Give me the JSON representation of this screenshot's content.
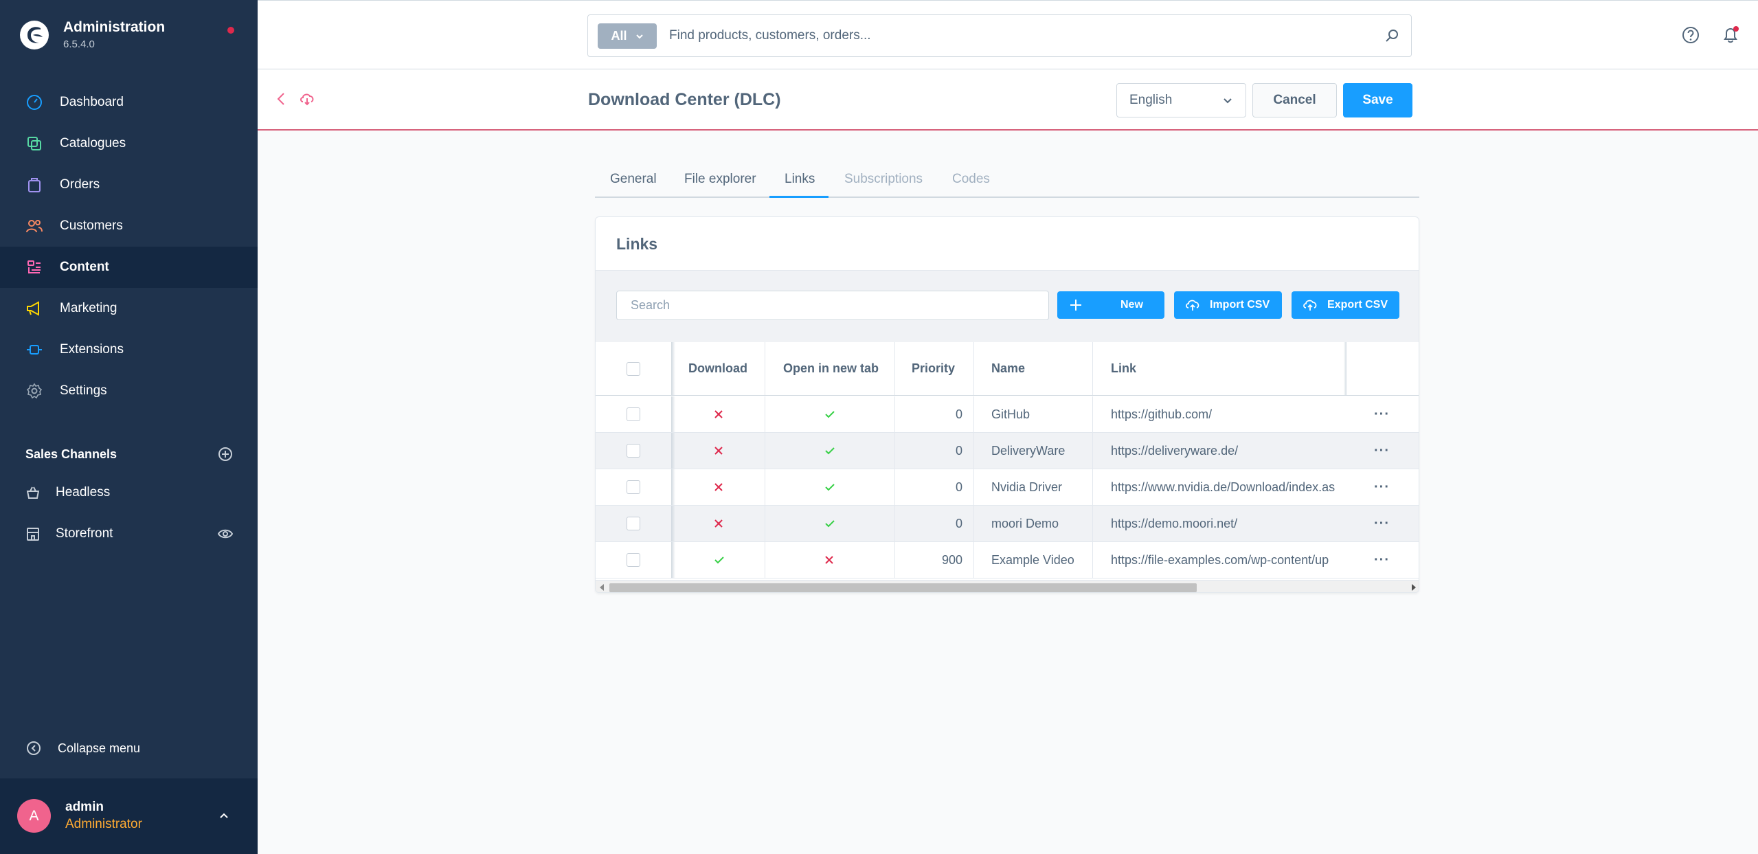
{
  "app": {
    "title": "Administration",
    "version": "6.5.4.0"
  },
  "sidebar": {
    "items": [
      {
        "label": "Dashboard",
        "icon": "dashboard-icon",
        "color": "#189eff"
      },
      {
        "label": "Catalogues",
        "icon": "catalogues-icon",
        "color": "#57d9a3"
      },
      {
        "label": "Orders",
        "icon": "orders-icon",
        "color": "#a092f0"
      },
      {
        "label": "Customers",
        "icon": "customers-icon",
        "color": "#f88962"
      },
      {
        "label": "Content",
        "icon": "content-icon",
        "color": "#ff68b4",
        "active": true
      },
      {
        "label": "Marketing",
        "icon": "marketing-icon",
        "color": "#ffd700"
      },
      {
        "label": "Extensions",
        "icon": "extensions-icon",
        "color": "#189eff"
      },
      {
        "label": "Settings",
        "icon": "settings-icon",
        "color": "#9aa8b5"
      }
    ],
    "sales_channels_title": "Sales Channels",
    "sales_channels": [
      {
        "label": "Headless",
        "icon": "basket-icon"
      },
      {
        "label": "Storefront",
        "icon": "storefront-icon"
      }
    ],
    "collapse_label": "Collapse menu",
    "user": {
      "initial": "A",
      "name": "admin",
      "role": "Administrator"
    }
  },
  "topbar": {
    "search_type": "All",
    "search_placeholder": "Find products, customers, orders..."
  },
  "smartbar": {
    "title": "Download Center (DLC)",
    "language": "English",
    "cancel_label": "Cancel",
    "save_label": "Save"
  },
  "tabs": [
    {
      "label": "General",
      "disabled": false
    },
    {
      "label": "File explorer",
      "disabled": false
    },
    {
      "label": "Links",
      "disabled": false,
      "active": true
    },
    {
      "label": "Subscriptions",
      "disabled": true
    },
    {
      "label": "Codes",
      "disabled": true
    }
  ],
  "card": {
    "title": "Links",
    "search_placeholder": "Search",
    "new_label": "New",
    "import_label": "Import CSV",
    "export_label": "Export CSV",
    "columns": [
      "Download",
      "Open in new tab",
      "Priority",
      "Name",
      "Link"
    ],
    "rows": [
      {
        "download": false,
        "new_tab": true,
        "priority": "0",
        "name": "GitHub",
        "link": "https://github.com/"
      },
      {
        "download": false,
        "new_tab": true,
        "priority": "0",
        "name": "DeliveryWare",
        "link": "https://deliveryware.de/"
      },
      {
        "download": false,
        "new_tab": true,
        "priority": "0",
        "name": "Nvidia Driver",
        "link": "https://www.nvidia.de/Download/index.as"
      },
      {
        "download": false,
        "new_tab": true,
        "priority": "0",
        "name": "moori Demo",
        "link": "https://demo.moori.net/"
      },
      {
        "download": true,
        "new_tab": false,
        "priority": "900",
        "name": "Example Video",
        "link": "https://file-examples.com/wp-content/up"
      }
    ],
    "row_actions_label": "···"
  },
  "colors": {
    "sidebar_bg": "#1f334d",
    "accent": "#189eff",
    "check": "#37d046",
    "cross": "#de294c",
    "admin_role": "#ffab33"
  }
}
